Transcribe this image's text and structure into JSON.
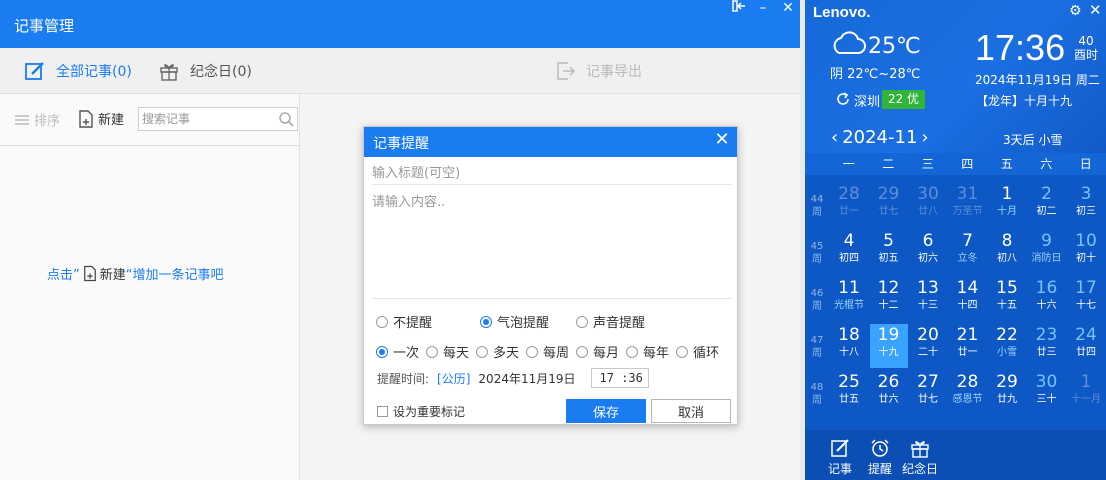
{
  "window": {
    "title": "记事管理"
  },
  "tabs": {
    "all_notes": "全部记事(0)",
    "anniversary": "纪念日(0)",
    "export": "记事导出"
  },
  "toolbar": {
    "sort": "排序",
    "new": "新建",
    "search_placeholder": "搜索记事"
  },
  "empty_hint": {
    "prefix": "点击”",
    "action": "新建",
    "suffix": "“增加一条记事吧"
  },
  "dialog": {
    "title": "记事提醒",
    "title_placeholder": "输入标题(可空)",
    "content_placeholder": "请输入内容..",
    "remind_types": [
      "不提醒",
      "气泡提醒",
      "声音提醒"
    ],
    "remind_type_selected": "气泡提醒",
    "repeat_options": [
      "一次",
      "每天",
      "多天",
      "每周",
      "每月",
      "每年",
      "循环"
    ],
    "repeat_selected": "一次",
    "time_label": "提醒时间:",
    "calendar_type": "[公历]",
    "date": "2024年11月19日",
    "time": "17 :36",
    "important_label": "设为重要标记",
    "save": "保存",
    "cancel": "取消"
  },
  "widget": {
    "brand": "Lenovo.",
    "weather_icon": "cloud-icon",
    "temperature": "25℃",
    "range": "阴 22℃~28℃",
    "city": "深圳",
    "aqi": "22 优",
    "clock": "17:36",
    "seconds": "40",
    "seconds_label": "酉时",
    "date": "2024年11月19日   周二",
    "lunar": "【龙年】十月十九",
    "month": "2024-11",
    "forecast": "3天后 小雪",
    "weekdays": [
      "一",
      "二",
      "三",
      "四",
      "五",
      "六",
      "日"
    ],
    "weeks": [
      {
        "wk": "44",
        "days": [
          {
            "d": "28",
            "l": "廿一",
            "dim": true
          },
          {
            "d": "29",
            "l": "廿七",
            "dim": true
          },
          {
            "d": "30",
            "l": "廿八",
            "dim": true
          },
          {
            "d": "31",
            "l": "万圣节",
            "dim": true
          },
          {
            "d": "1",
            "l": "十月",
            "fest": true
          },
          {
            "d": "2",
            "l": "初二",
            "we": true
          },
          {
            "d": "3",
            "l": "初三",
            "we": true
          }
        ]
      },
      {
        "wk": "45",
        "days": [
          {
            "d": "4",
            "l": "初四"
          },
          {
            "d": "5",
            "l": "初五"
          },
          {
            "d": "6",
            "l": "初六"
          },
          {
            "d": "7",
            "l": "立冬",
            "fest": true
          },
          {
            "d": "8",
            "l": "初八"
          },
          {
            "d": "9",
            "l": "消防日",
            "we": true,
            "fest": true
          },
          {
            "d": "10",
            "l": "初十",
            "we": true
          }
        ]
      },
      {
        "wk": "46",
        "days": [
          {
            "d": "11",
            "l": "光棍节",
            "fest": true
          },
          {
            "d": "12",
            "l": "十二"
          },
          {
            "d": "13",
            "l": "十三"
          },
          {
            "d": "14",
            "l": "十四"
          },
          {
            "d": "15",
            "l": "十五"
          },
          {
            "d": "16",
            "l": "十六",
            "we": true
          },
          {
            "d": "17",
            "l": "十七",
            "we": true
          }
        ]
      },
      {
        "wk": "47",
        "days": [
          {
            "d": "18",
            "l": "十八"
          },
          {
            "d": "19",
            "l": "十九",
            "today": true
          },
          {
            "d": "20",
            "l": "二十"
          },
          {
            "d": "21",
            "l": "廿一"
          },
          {
            "d": "22",
            "l": "小雪",
            "fest": true
          },
          {
            "d": "23",
            "l": "廿三",
            "we": true
          },
          {
            "d": "24",
            "l": "廿四",
            "we": true
          }
        ]
      },
      {
        "wk": "48",
        "days": [
          {
            "d": "25",
            "l": "廿五"
          },
          {
            "d": "26",
            "l": "廿六"
          },
          {
            "d": "27",
            "l": "廿七"
          },
          {
            "d": "28",
            "l": "感恩节",
            "fest": true
          },
          {
            "d": "29",
            "l": "廿九"
          },
          {
            "d": "30",
            "l": "三十",
            "we": true
          },
          {
            "d": "1",
            "l": "十一月",
            "dim": true
          }
        ]
      }
    ],
    "week_suffix": "周",
    "bottom": [
      "记事",
      "提醒",
      "纪念日"
    ]
  }
}
